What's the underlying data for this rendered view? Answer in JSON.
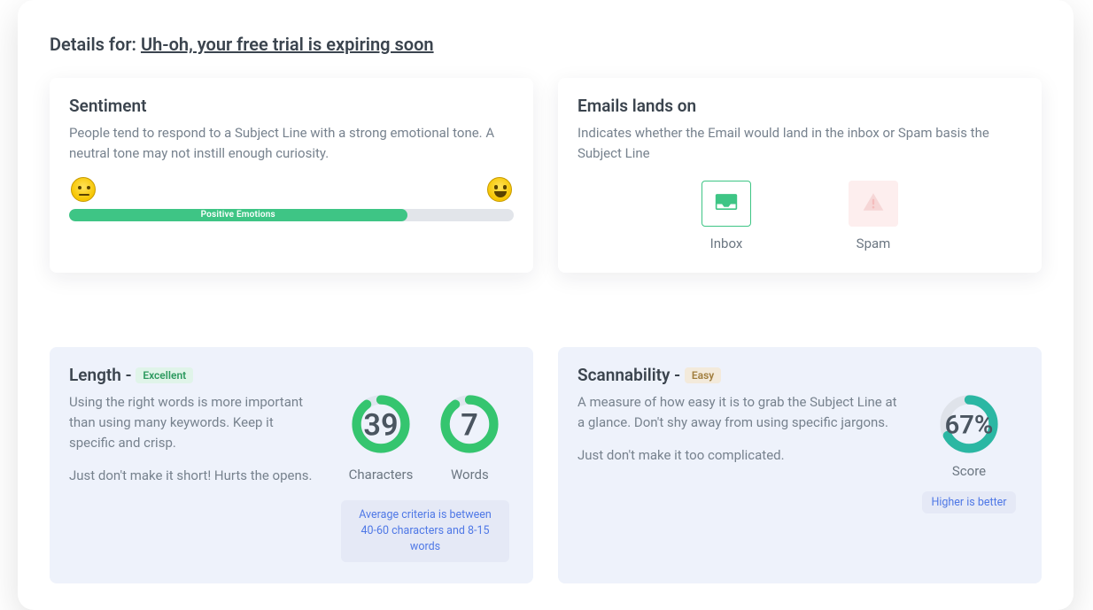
{
  "header": {
    "prefix": "Details for:",
    "subject": "Uh-oh, your free trial is expiring soon"
  },
  "sentiment": {
    "title": "Sentiment",
    "desc": "People tend to respond to a Subject Line with a strong emotional tone. A neutral tone may not instill enough curiosity.",
    "bar_label": "Positive Emotions",
    "fill_pct": 76,
    "fill_color": "#3ec585"
  },
  "lands": {
    "title": "Emails lands on",
    "desc": "Indicates whether the Email would land in the inbox or Spam basis the Subject Line",
    "inbox_label": "Inbox",
    "spam_label": "Spam",
    "selected": "inbox"
  },
  "length": {
    "title_prefix": "Length -",
    "badge": "Excellent",
    "desc1": "Using the right words is more important than using many keywords. Keep it specific and crisp.",
    "desc2": "Just don't make it short! Hurts the opens.",
    "characters": {
      "value": 39,
      "label": "Characters",
      "pct": 90
    },
    "words": {
      "value": 7,
      "label": "Words",
      "pct": 90
    },
    "criteria": "Average criteria is between 40-60 characters and 8-15 words",
    "ring_color": "#35c56f"
  },
  "scannability": {
    "title_prefix": "Scannability -",
    "badge": "Easy",
    "desc1": "A measure of how easy it is to grab the Subject Line at a glance. Don't shy away from using specific jargons.",
    "desc2": "Just don't make it too complicated.",
    "score_pct": 67,
    "score_text": "67%",
    "score_label": "Score",
    "note": "Higher is better",
    "ring_color": "#2bb7a3"
  }
}
